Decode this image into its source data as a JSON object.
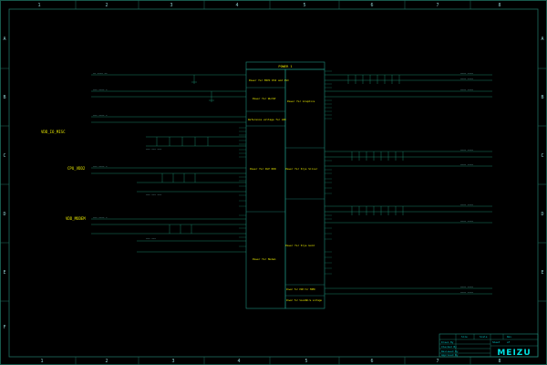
{
  "sheet": {
    "column_labels": [
      "1",
      "2",
      "3",
      "4",
      "5",
      "6",
      "7",
      "8"
    ],
    "row_labels": [
      "A",
      "B",
      "C",
      "D",
      "E",
      "F"
    ]
  },
  "blocks": {
    "main_title": "POWER 1",
    "groups": [
      "Power for MIPI DSI and CSI",
      "Power for WLCSP",
      "Reference voltage for ADC",
      "Power for Graphics",
      "Power for PoP DDR",
      "Power for Krys Silver",
      "Power for Krys Gold",
      "Power for Modem",
      "Power for PAM for MIMO",
      "Power for SoundWire voltage"
    ]
  },
  "rail_labels": {
    "vddio_misc": "VDD_IO_MISC",
    "cpu_vdd2": "CPU_VDD2",
    "vdd_modem": "VDD_MODEM"
  },
  "title_block": {
    "header_1": "Size",
    "header_2": "Scale",
    "header_3": "Rev",
    "drawn_by": "Drawn By",
    "checked_by": "Checked By",
    "reviewed_by": "Reviewed By",
    "approved_by": "Approved By",
    "sheet_label": "Sheet",
    "of_label": "of",
    "logo": "MEIZU"
  }
}
